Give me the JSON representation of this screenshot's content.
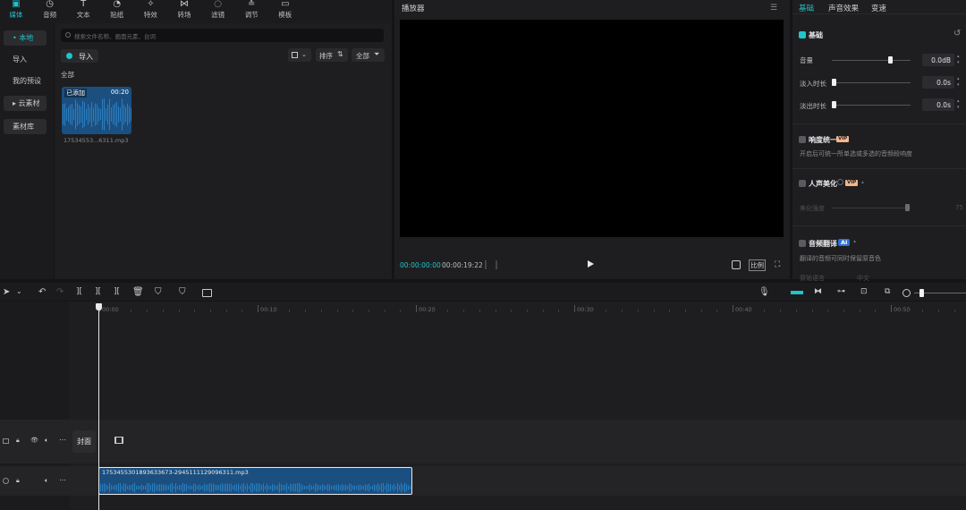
{
  "toolbar": {
    "tabs": [
      {
        "label": "媒体",
        "icon": "media-icon"
      },
      {
        "label": "音频",
        "icon": "audio-icon"
      },
      {
        "label": "文本",
        "icon": "text-icon"
      },
      {
        "label": "贴纸",
        "icon": "sticker-icon"
      },
      {
        "label": "特效",
        "icon": "effects-icon"
      },
      {
        "label": "转场",
        "icon": "transition-icon"
      },
      {
        "label": "滤镜",
        "icon": "filter-icon"
      },
      {
        "label": "调节",
        "icon": "adjust-icon"
      },
      {
        "label": "模板",
        "icon": "template-icon"
      }
    ],
    "active": "媒体"
  },
  "sidebar": {
    "items": [
      "• 本地",
      "导入",
      "我的预设",
      "▸ 云素材",
      "素材库"
    ]
  },
  "media": {
    "search_placeholder": "搜索文件名称、画面元素、台词",
    "import_label": "导入",
    "sort_label": "排序",
    "filter_label": "全部",
    "section_label": "全部",
    "clip": {
      "badge": "已添加",
      "duration": "00:20",
      "filename": "17534553...6311.mp3"
    }
  },
  "player": {
    "title": "播放器",
    "current_time": "00:00:00:00",
    "total_time": "00:00:19:22",
    "ratio_label": "比例"
  },
  "inspector": {
    "tabs": [
      "基础",
      "声音效果",
      "变速"
    ],
    "basic_title": "基础",
    "volume_label": "音量",
    "volume_value": "0.0dB",
    "volume_level": 0.74,
    "fade_in_label": "淡入时长",
    "fade_in_value": "0.0s",
    "fade_out_label": "淡出时长",
    "fade_out_value": "0.0s",
    "loudness_title": "响度统一",
    "loudness_desc": "开启后可统一所单选或多选的音频段响度",
    "voice_title": "人声美化",
    "voice_strength_label": "美化强度",
    "voice_strength_value": "75",
    "translate_title": "音频翻译",
    "translate_badge": "AI",
    "translate_desc": "翻译的音频可同时保留原音色",
    "translate_lang_label": "原始语言",
    "translate_lang_value": "中文",
    "vip": "VIP"
  },
  "timeline": {
    "ticks": [
      "00:00",
      "00:10",
      "00:20",
      "00:30",
      "00:40",
      "00:50"
    ],
    "cover_label": "封面",
    "audio_clip_name": "1753455301893633673-2945111129096311.mp3"
  },
  "colors": {
    "accent": "#20c4cb",
    "panel": "#1e1e20",
    "audio_clip": "#1b4f7f",
    "vip": "#f3b58a"
  }
}
